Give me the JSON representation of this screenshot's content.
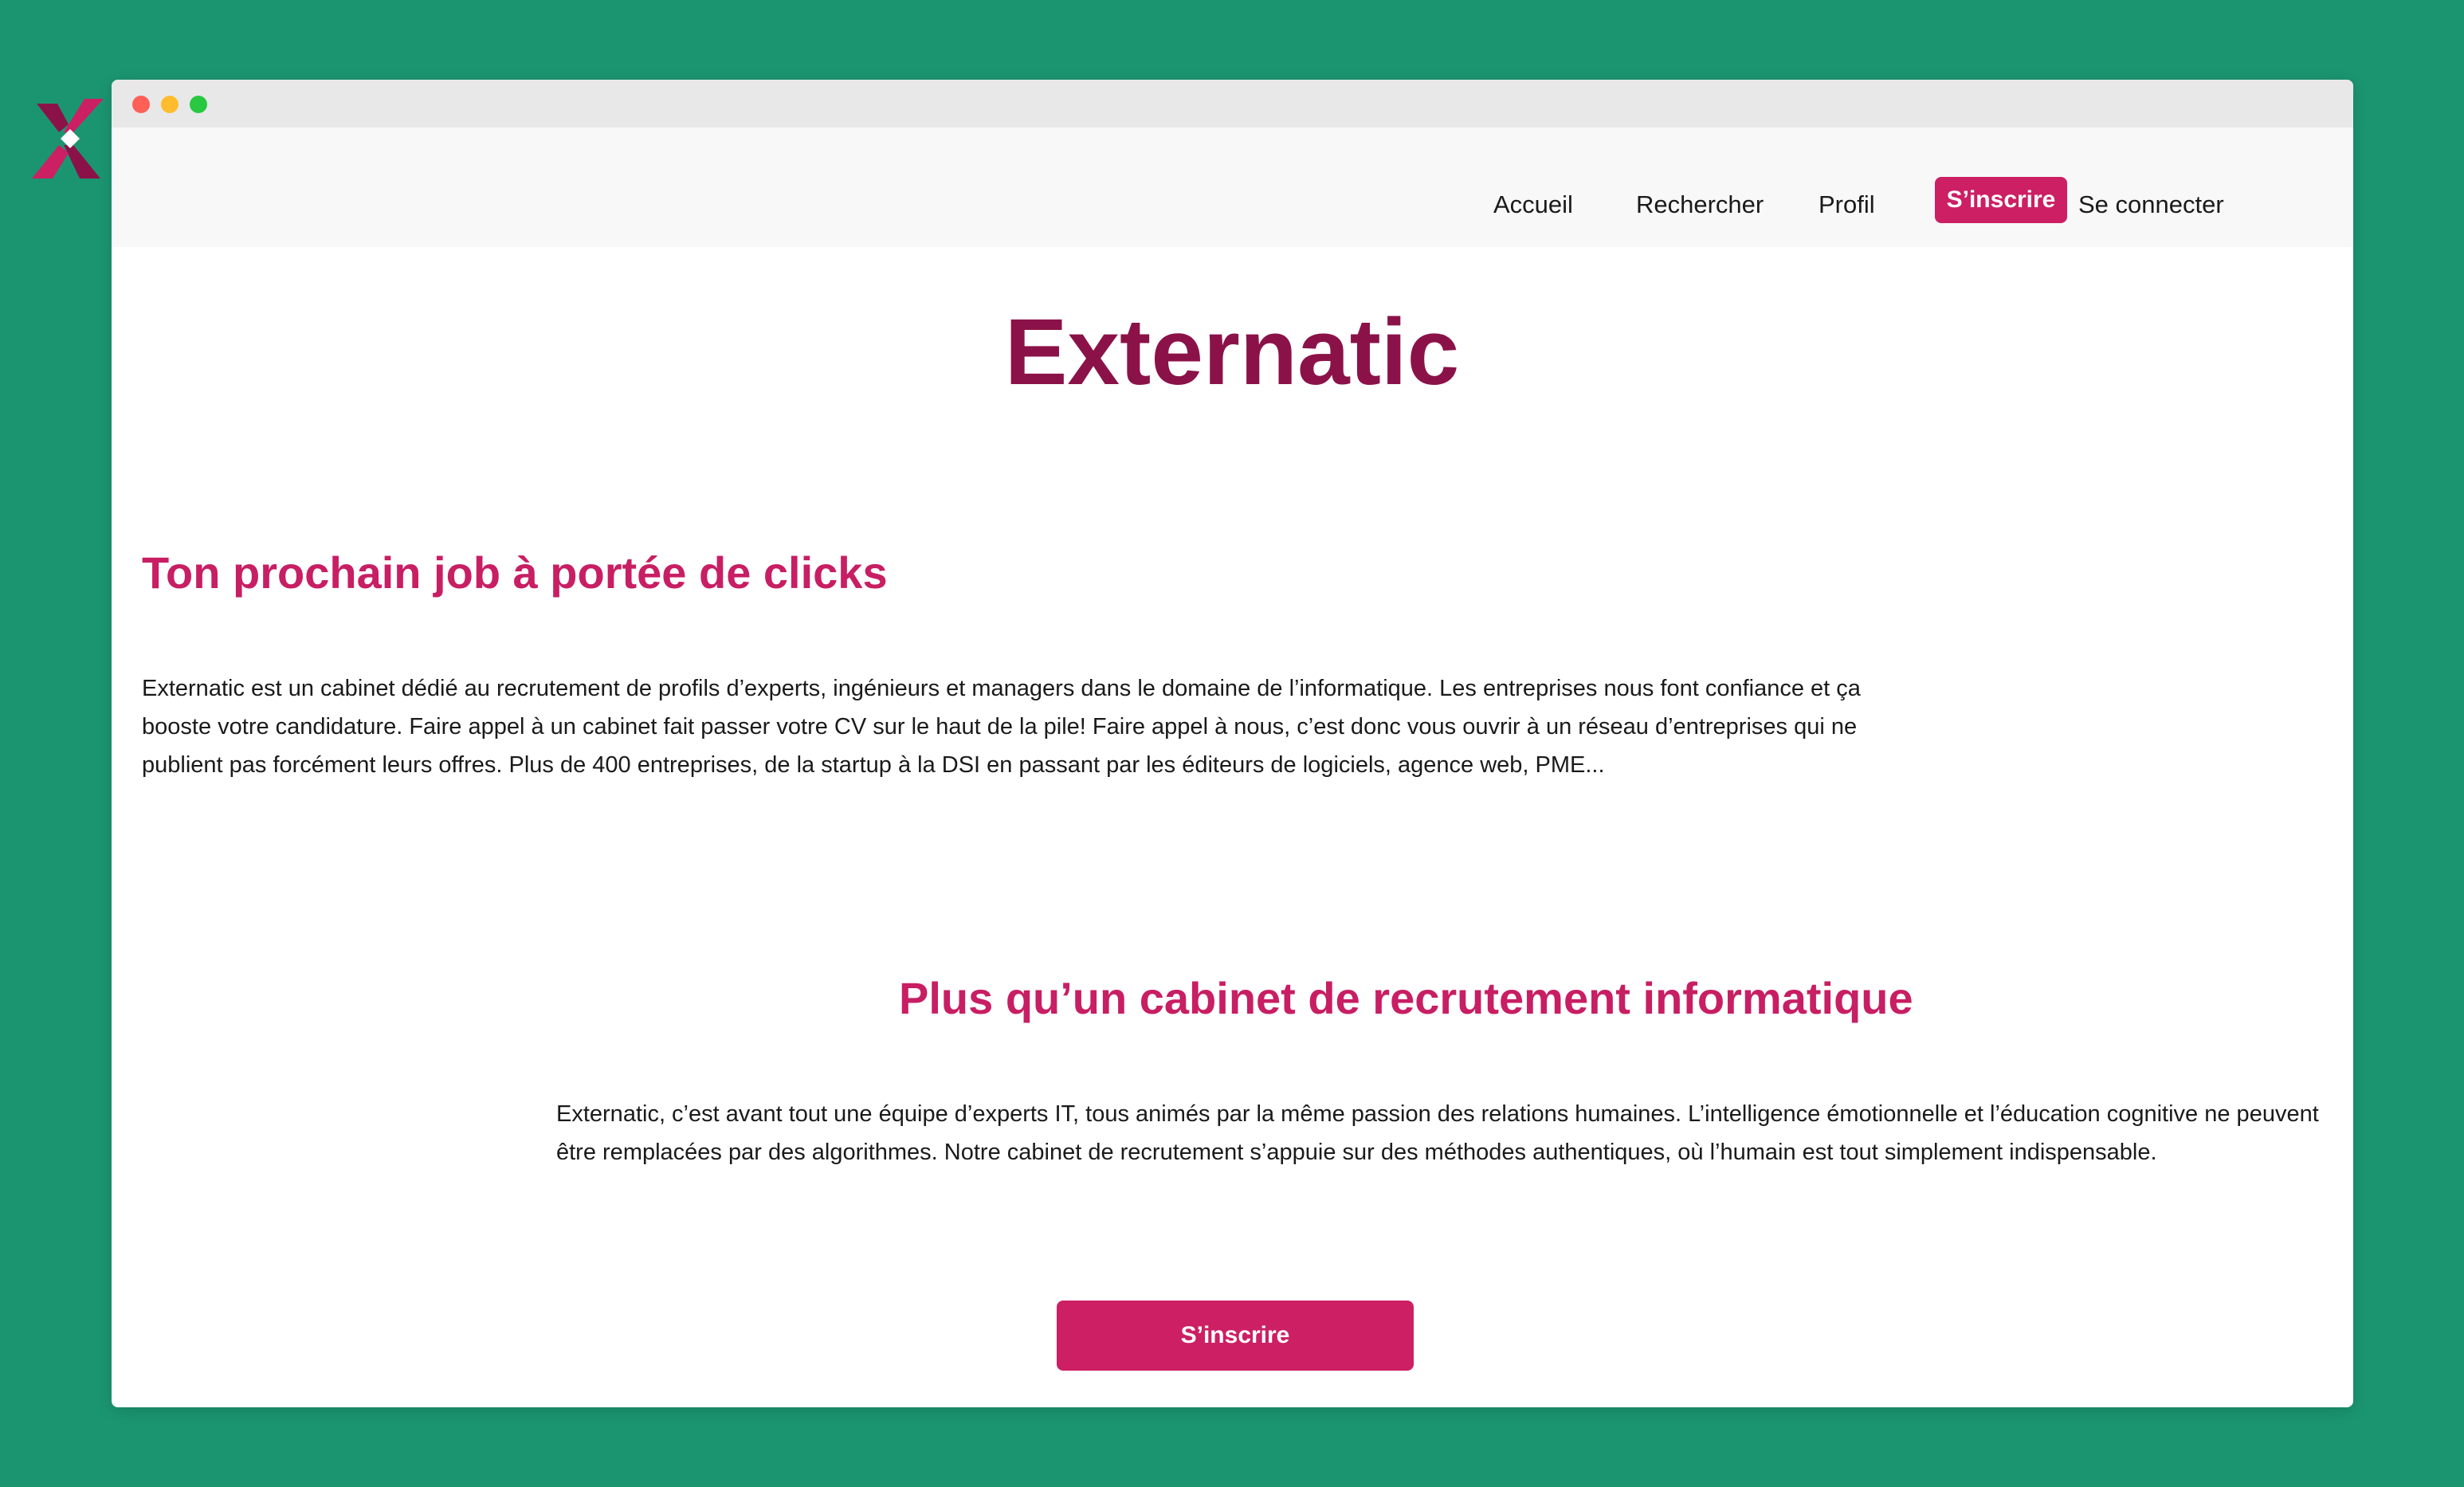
{
  "app": {
    "brand_name": "Externatic"
  },
  "nav": {
    "items": [
      {
        "label": "Accueil"
      },
      {
        "label": "Rechercher"
      },
      {
        "label": "Profil"
      }
    ],
    "signup_label": "S’inscrire",
    "login_label": "Se connecter"
  },
  "main": {
    "title": "Externatic",
    "section1": {
      "heading": "Ton prochain job à portée de clicks",
      "text": "Externatic est un cabinet dédié au recrutement de profils d’experts, ingénieurs et managers dans le domaine de l’informatique. Les entreprises nous font confiance et ça booste votre candidature. Faire appel à un cabinet fait passer votre CV sur le haut de la pile! Faire appel à nous, c’est donc vous ouvrir à un réseau d’entreprises qui ne publient pas forcément leurs offres. Plus de 400 entreprises, de la startup à la DSI en passant par les éditeurs de logiciels, agence web, PME..."
    },
    "section2": {
      "heading": "Plus qu’un cabinet de recrutement informatique",
      "text": "Externatic, c’est avant tout une équipe d’experts IT, tous animés par la même passion des relations humaines. L’intelligence émotionnelle et l’éducation cognitive ne peuvent être remplacées par des algorithmes. Notre cabinet de recrutement s’appuie sur des méthodes authentiques, où l’humain est tout simplement indispensable."
    },
    "cta_label": "S’inscrire"
  },
  "colors": {
    "background": "#1b9570",
    "brand_dark": "#8b1249",
    "brand_accent": "#cc1f64",
    "navbar_bg": "#f8f8f8"
  },
  "icons": {
    "logo": "externatic-x-logo"
  }
}
